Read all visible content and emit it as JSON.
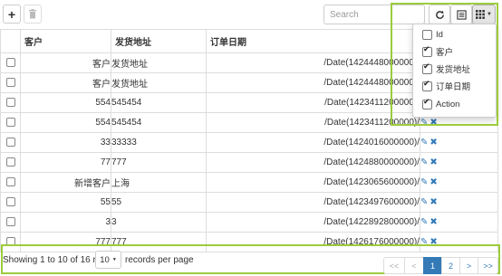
{
  "toolbar": {
    "add_icon": "plus-icon",
    "delete_icon": "trash-icon",
    "refresh_icon": "refresh-icon",
    "toggle_icon": "list-alt-icon",
    "columns_icon": "grid-icon",
    "search_placeholder": "Search"
  },
  "table": {
    "headers": [
      "客户",
      "发货地址",
      "订单日期",
      ""
    ],
    "rows": [
      {
        "customer": "客户",
        "address": "发货地址",
        "date": "/Date(1424448000000)/"
      },
      {
        "customer": "客户",
        "address": "发货地址",
        "date": "/Date(1424448000000)/"
      },
      {
        "customer": "554",
        "address": "545454",
        "date": "/Date(1423411200000)/"
      },
      {
        "customer": "554",
        "address": "545454",
        "date": "/Date(1423411200000)/"
      },
      {
        "customer": "33",
        "address": "33333",
        "date": "/Date(1424016000000)/"
      },
      {
        "customer": "77",
        "address": "777",
        "date": "/Date(1424880000000)/"
      },
      {
        "customer": "新增客户",
        "address": "上海",
        "date": "/Date(1423065600000)/"
      },
      {
        "customer": "55",
        "address": "55",
        "date": "/Date(1423497600000)/"
      },
      {
        "customer": "3",
        "address": "3",
        "date": "/Date(1422892800000)/"
      },
      {
        "customer": "777",
        "address": "777",
        "date": "/Date(1426176000000)/"
      }
    ]
  },
  "columns_menu": {
    "items": [
      {
        "label": "Id",
        "checked": false
      },
      {
        "label": "客户",
        "checked": true
      },
      {
        "label": "发货地址",
        "checked": true
      },
      {
        "label": "订单日期",
        "checked": true
      },
      {
        "label": "Action",
        "checked": true
      }
    ]
  },
  "footer": {
    "showing_text": "Showing 1 to 10 of 16 rows",
    "page_size": "10",
    "records_text": "records per page"
  },
  "pagination": {
    "first": "<<",
    "prev": "<",
    "pages": [
      "1",
      "2"
    ],
    "active_page": "1",
    "next": ">",
    "last": ">>"
  },
  "colors": {
    "highlight": "#9ccc3d",
    "accent": "#337ab7"
  }
}
